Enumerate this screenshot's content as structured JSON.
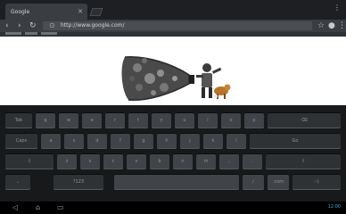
{
  "browser": {
    "tab_title": "Google",
    "tab_close_icon": "close-icon",
    "url": "http://www.google.com/",
    "back_icon": "back-arrow-icon",
    "forward_icon": "forward-arrow-icon",
    "reload_icon": "reload-icon",
    "star_icon": "bookmark-star-icon",
    "mic_icon": "microphone-icon",
    "menu_icon": "overflow-menu-icon"
  },
  "page": {
    "doodle_icon": "google-doodle-icon"
  },
  "keyboard": {
    "rows": [
      [
        {
          "k": "tab",
          "t": "Tab"
        },
        {
          "k": "q",
          "t": "q"
        },
        {
          "k": "w",
          "t": "w"
        },
        {
          "k": "e",
          "t": "e"
        },
        {
          "k": "r",
          "t": "r"
        },
        {
          "k": "t",
          "t": "t"
        },
        {
          "k": "y",
          "t": "y"
        },
        {
          "k": "u",
          "t": "u"
        },
        {
          "k": "i",
          "t": "i"
        },
        {
          "k": "o",
          "t": "o"
        },
        {
          "k": "p",
          "t": "p"
        },
        {
          "k": "del",
          "t": "⌫"
        }
      ],
      [
        {
          "k": "caps",
          "t": "Caps"
        },
        {
          "k": "a",
          "t": "a"
        },
        {
          "k": "s",
          "t": "s"
        },
        {
          "k": "d",
          "t": "d"
        },
        {
          "k": "f",
          "t": "f"
        },
        {
          "k": "g",
          "t": "g"
        },
        {
          "k": "h",
          "t": "h"
        },
        {
          "k": "j",
          "t": "j"
        },
        {
          "k": "k",
          "t": "k"
        },
        {
          "k": "l",
          "t": "l"
        },
        {
          "k": "go",
          "t": "Go"
        }
      ],
      [
        {
          "k": "shift",
          "t": "⇧"
        },
        {
          "k": "z",
          "t": "z"
        },
        {
          "k": "x",
          "t": "x"
        },
        {
          "k": "c",
          "t": "c"
        },
        {
          "k": "v",
          "t": "v"
        },
        {
          "k": "b",
          "t": "b"
        },
        {
          "k": "n",
          "t": "n"
        },
        {
          "k": "m",
          "t": "m"
        },
        {
          "k": "comma",
          "t": ","
        },
        {
          "k": "period",
          "t": "."
        },
        {
          "k": "shift2",
          "t": "⇧"
        }
      ],
      [
        {
          "k": "hide",
          "t": "⌄"
        },
        {
          "k": "sym",
          "t": "?123"
        },
        {
          "k": "space",
          "t": " "
        },
        {
          "k": "slash",
          "t": "/"
        },
        {
          "k": "com",
          "t": ".com"
        },
        {
          "k": "emoji",
          "t": ":-)"
        }
      ]
    ]
  },
  "systembar": {
    "back_icon": "system-back-icon",
    "home_icon": "home-icon",
    "recents_icon": "recent-apps-icon",
    "status": "12:00"
  }
}
